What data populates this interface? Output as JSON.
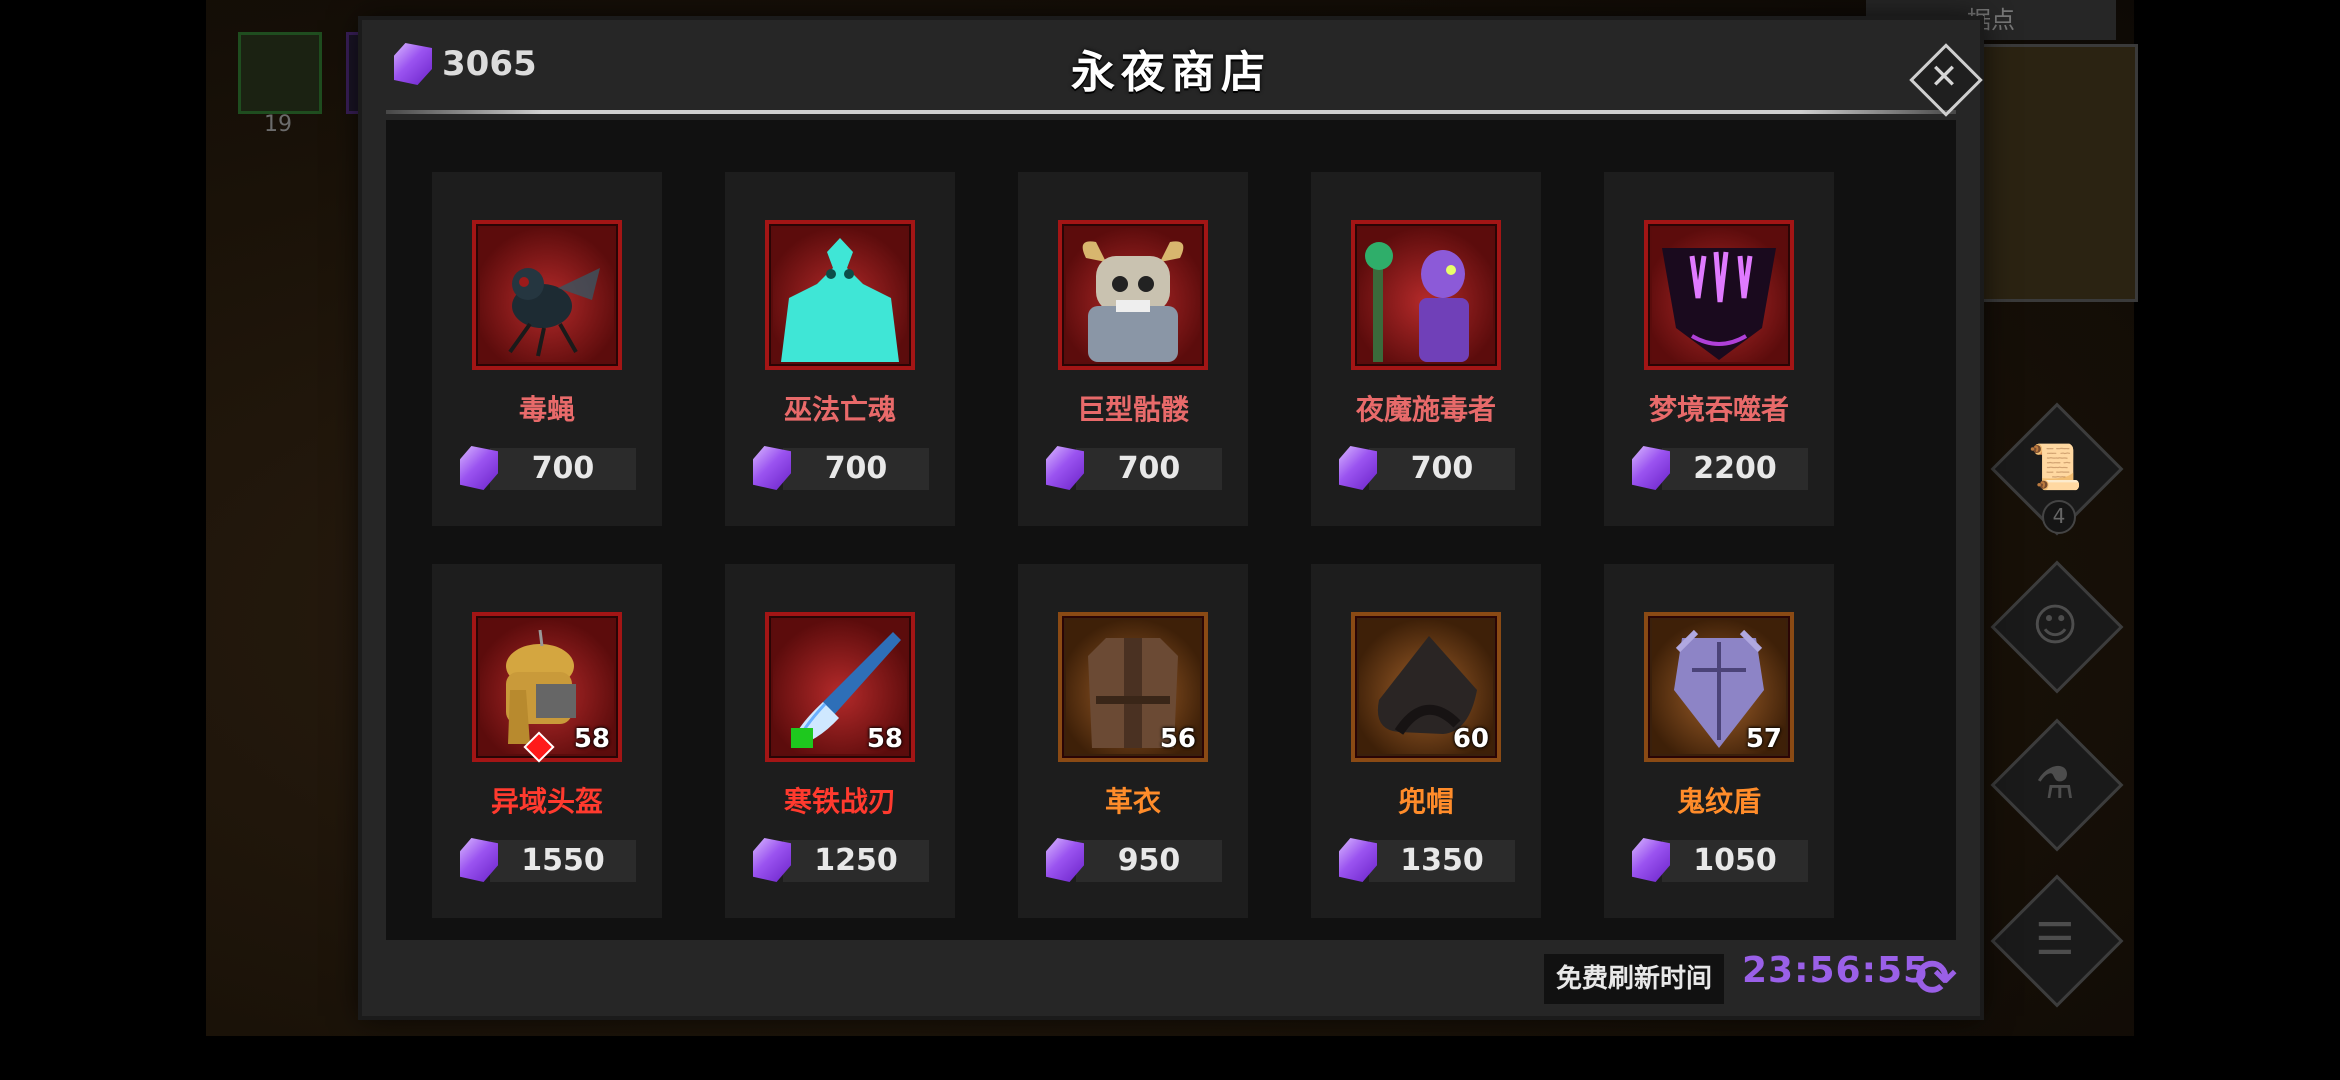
{
  "background": {
    "slot_count": "19",
    "minimap_label": "据点",
    "side_buttons": [
      {
        "icon": "scroll-icon",
        "badge": "4"
      },
      {
        "icon": "people-icon",
        "badge": ""
      },
      {
        "icon": "potion-icon",
        "badge": ""
      },
      {
        "icon": "list-icon",
        "badge": ""
      }
    ]
  },
  "shop": {
    "title": "永夜商店",
    "currency": "3065",
    "refresh_label": "免费刷新时间",
    "refresh_timer": "23:56:55"
  },
  "items": [
    {
      "name": "毒蝇",
      "price": "700",
      "level": "",
      "kind": "unit",
      "art": "fly"
    },
    {
      "name": "巫法亡魂",
      "price": "700",
      "level": "",
      "kind": "unit",
      "art": "wraith"
    },
    {
      "name": "巨型骷髅",
      "price": "700",
      "level": "",
      "kind": "unit",
      "art": "skull"
    },
    {
      "name": "夜魔施毒者",
      "price": "700",
      "level": "",
      "kind": "unit",
      "art": "poisoner"
    },
    {
      "name": "梦境吞噬者",
      "price": "2200",
      "level": "",
      "kind": "unit",
      "art": "devourer"
    },
    {
      "name": "异域头盔",
      "price": "1550",
      "level": "58",
      "kind": "red",
      "art": "helmet"
    },
    {
      "name": "寒铁战刃",
      "price": "1250",
      "level": "58",
      "kind": "red",
      "art": "blade"
    },
    {
      "name": "革衣",
      "price": "950",
      "level": "56",
      "kind": "orange",
      "art": "leather"
    },
    {
      "name": "兜帽",
      "price": "1350",
      "level": "60",
      "kind": "orange",
      "art": "hood"
    },
    {
      "name": "鬼纹盾",
      "price": "1050",
      "level": "57",
      "kind": "orange",
      "art": "shield"
    }
  ],
  "colors": {
    "currency_gem": "#9a53f0",
    "rare_frame": "#a31515",
    "epic_frame": "#8a4a14",
    "timer": "#9a60e8"
  }
}
